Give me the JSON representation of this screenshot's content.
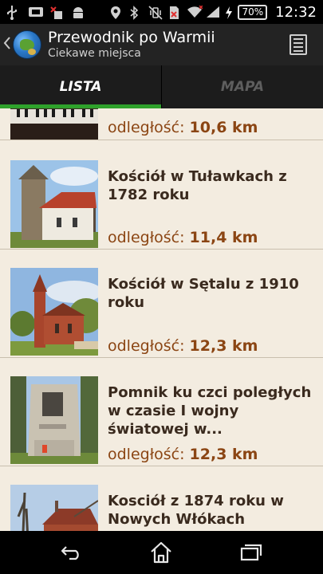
{
  "status_bar": {
    "icons_left": [
      "usb-icon",
      "sd-card-icon",
      "missed-notification-icon",
      "android-icon"
    ],
    "icons_right": [
      "location-icon",
      "bluetooth-icon",
      "vibrate-icon",
      "no-sim-icon",
      "wifi-icon",
      "signal-icon",
      "charging-icon"
    ],
    "battery": "70%",
    "time": "12:32"
  },
  "action_bar": {
    "title": "Przewodnik po Warmii",
    "subtitle": "Ciekawe miejsca",
    "up_icon": "chevron-left-icon",
    "menu_icon": "list-menu-icon"
  },
  "tabs": [
    {
      "label": "LISTA",
      "active": true
    },
    {
      "label": "MAPA",
      "active": false
    }
  ],
  "list": {
    "distance_label": "odległość:",
    "items": [
      {
        "title": "",
        "distance": "10,6 km",
        "thumb": "piano"
      },
      {
        "title": "Kościół w Tuławkach z 1782 roku",
        "distance": "11,4 km",
        "thumb": "wooden-church"
      },
      {
        "title": "Kościół w Sętalu z 1910 roku",
        "distance": "12,3 km",
        "thumb": "brick-church"
      },
      {
        "title": "Pomnik ku czci poległych w czasie I wojny światowej w...",
        "distance": "12,3 km",
        "thumb": "monument"
      },
      {
        "title": "Kosciół z 1874 roku w Nowych Włókach",
        "distance": "",
        "thumb": "church-trees"
      }
    ]
  },
  "nav_bar": {
    "icons": [
      "back-icon",
      "home-icon",
      "recent-apps-icon"
    ]
  },
  "colors": {
    "accent": "#2fa12b",
    "list_background": "#f3ece0",
    "title_text": "#3a2a1e",
    "distance_text": "#8b4513"
  }
}
